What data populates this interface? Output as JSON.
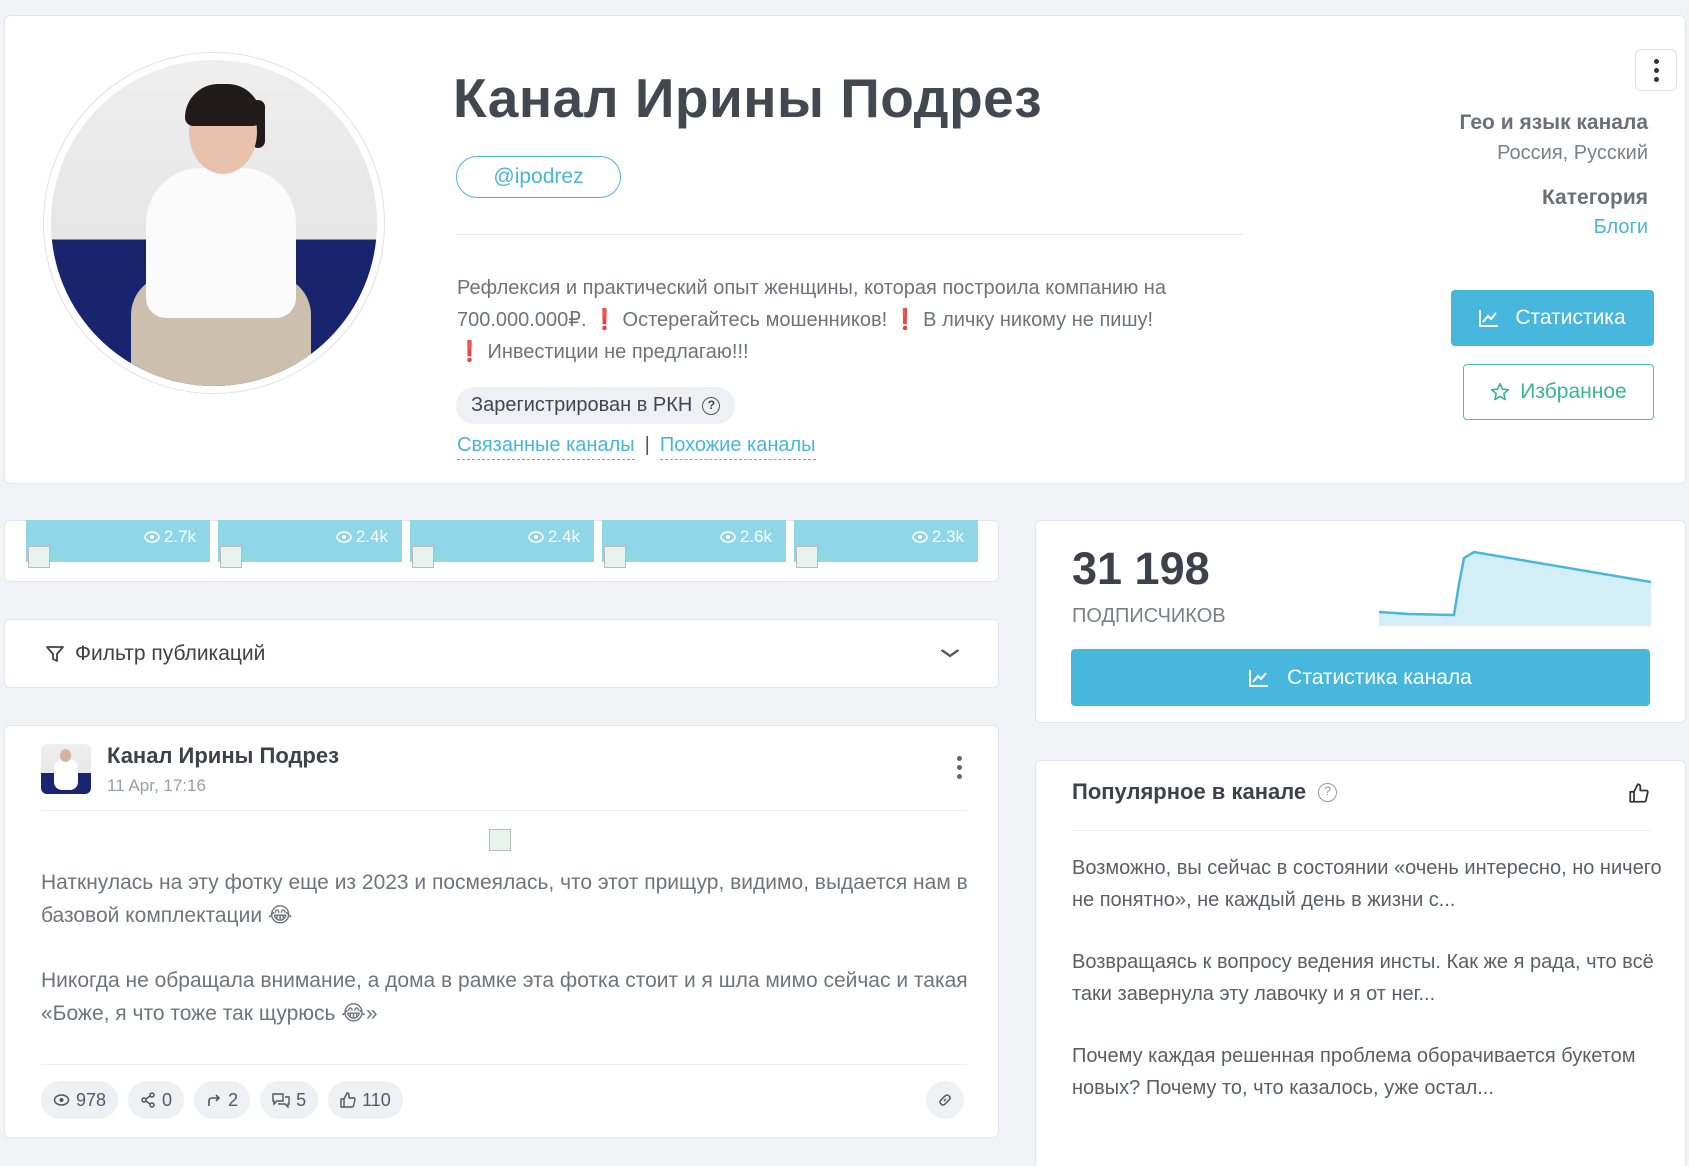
{
  "channel": {
    "title": "Канал Ирины Подрез",
    "handle": "@ipodrez",
    "description_line1": "Рефлексия и практический опыт женщины, которая построила компанию на",
    "description_line2a": "700.000.000₽. ",
    "description_line2b": " Остерегайтесь мошенников! ",
    "description_line2c": " В личку никому не пишу!",
    "description_line3": " Инвестиции не предлагаю!!!",
    "exclamation": "❗",
    "rkn_badge": "Зарегистрирован в РКН",
    "related_link": "Связанные каналы",
    "similar_link": "Похожие каналы",
    "link_separator": "|"
  },
  "meta": {
    "geo_label": "Гео и язык канала",
    "geo_value": "Россия, Русский",
    "category_label": "Категория",
    "category_value": "Блоги"
  },
  "buttons": {
    "stats": "Статистика",
    "favorite": "Избранное",
    "channel_stats": "Статистика канала"
  },
  "thumbs": [
    {
      "views": "2.7k"
    },
    {
      "views": "2.4k"
    },
    {
      "views": "2.4k"
    },
    {
      "views": "2.6k"
    },
    {
      "views": "2.3k"
    }
  ],
  "filter": {
    "label": "Фильтр публикаций"
  },
  "post": {
    "author": "Канал Ирины Подрез",
    "date": "11 Apr, 17:16",
    "paragraph1": "Наткнулась на эту фотку еще из 2023 и посмеялась, что этот прищур, видимо, выдается нам в базовой комплектации 😂",
    "paragraph2": "Никогда не обращала внимание, а дома в рамке эта фотка стоит и я шла мимо сейчас и такая «Боже, я что тоже так щурюсь 😂»",
    "stats": {
      "views": "978",
      "shares": "0",
      "forwards": "2",
      "comments": "5",
      "likes": "110"
    }
  },
  "subscribers": {
    "count": "31 198",
    "label": "ПОДПИСЧИКОВ",
    "trend_color": "#48b7dd"
  },
  "popular": {
    "title": "Популярное в канале",
    "items": [
      {
        "text": "Возможно, вы сейчас в состоянии «очень интересно, но ничего не понятно», не каждый день в жизни с..."
      },
      {
        "text": "Возвращаясь к вопросу ведения инсты. Как же я рада, что всё таки завернула эту лавочку и я от нег..."
      },
      {
        "text": "Почему каждая решенная проблема оборачивается букетом новых? Почему то, что казалось, уже остал..."
      }
    ]
  },
  "colors": {
    "accent": "#48b7dd",
    "favorite": "#3bb78e",
    "danger": "#e02a3a"
  }
}
